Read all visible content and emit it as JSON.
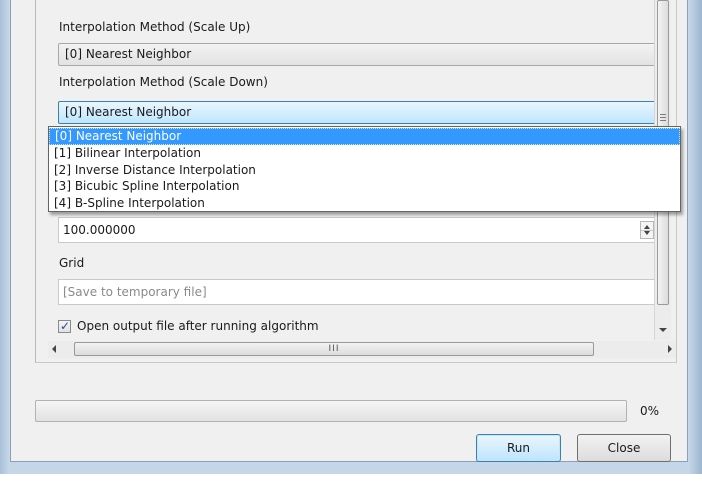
{
  "params": {
    "scale_up_label": "Interpolation Method (Scale Up)",
    "scale_up_value": "[0] Nearest Neighbor",
    "scale_down_label": "Interpolation Method (Scale Down)",
    "scale_down_value": "[0] Nearest Neighbor",
    "dropdown_options": [
      "[0] Nearest Neighbor",
      "[1] Bilinear Interpolation",
      "[2] Inverse Distance Interpolation",
      "[3] Bicubic Spline Interpolation",
      "[4] B-Spline Interpolation"
    ],
    "selected_option_index": 0,
    "numeric_value": "100.000000",
    "grid_label": "Grid",
    "grid_placeholder": "[Save to temporary file]",
    "open_output_label": "Open output file after running algorithm",
    "open_output_checked": true
  },
  "hscroll": {
    "thumb_grip": "III"
  },
  "progress": {
    "value": 0,
    "text": "0%"
  },
  "buttons": {
    "run": "Run",
    "close": "Close"
  },
  "colors": {
    "selection": "#3399ff",
    "focus_border": "#3c7fb1",
    "window_frame": "#c5d6e9"
  }
}
